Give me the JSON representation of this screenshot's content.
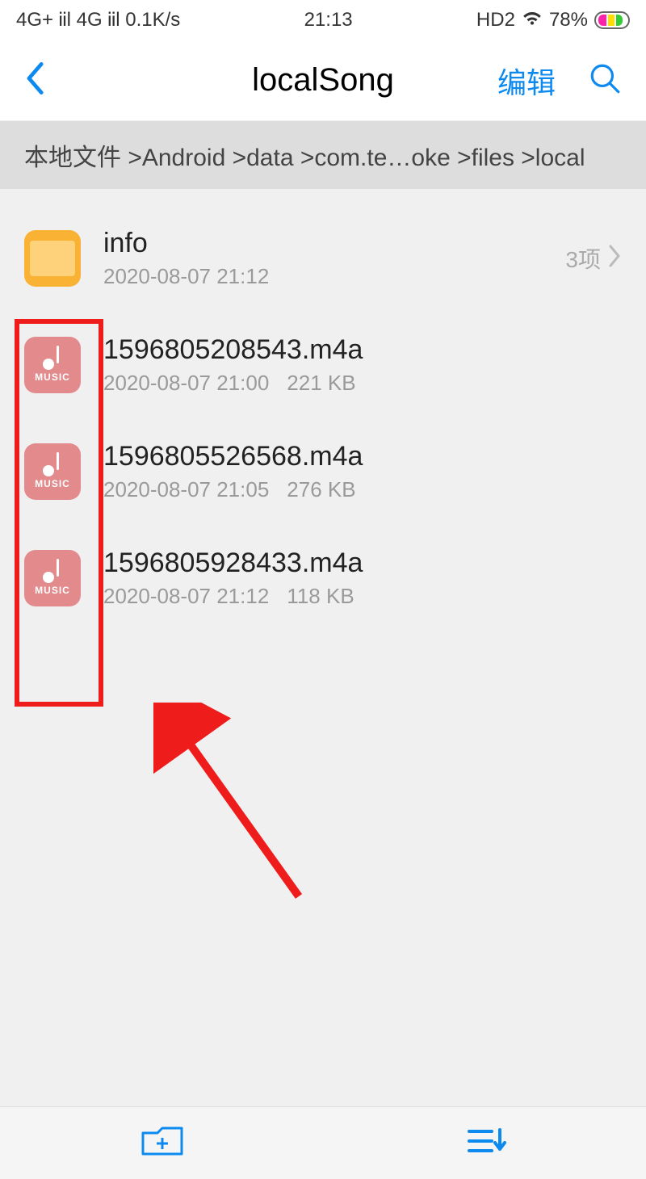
{
  "statusbar": {
    "left": "4G+ ᎥᎥl 4G ᎥᎥl 0.1K/s",
    "time": "21:13",
    "right_label": "HD2",
    "battery": "78%"
  },
  "nav": {
    "title": "localSong",
    "edit": "编辑"
  },
  "breadcrumb": "本地文件 >Android >data >com.te…oke >files >local",
  "folder": {
    "name": "info",
    "date": "2020-08-07 21:12",
    "count": "3项"
  },
  "files": [
    {
      "name": "1596805208543.m4a",
      "date": "2020-08-07 21:00",
      "size": "221 KB"
    },
    {
      "name": "1596805526568.m4a",
      "date": "2020-08-07 21:05",
      "size": "276 KB"
    },
    {
      "name": "1596805928433.m4a",
      "date": "2020-08-07 21:12",
      "size": "118 KB"
    }
  ],
  "music_label": "MUSIC"
}
